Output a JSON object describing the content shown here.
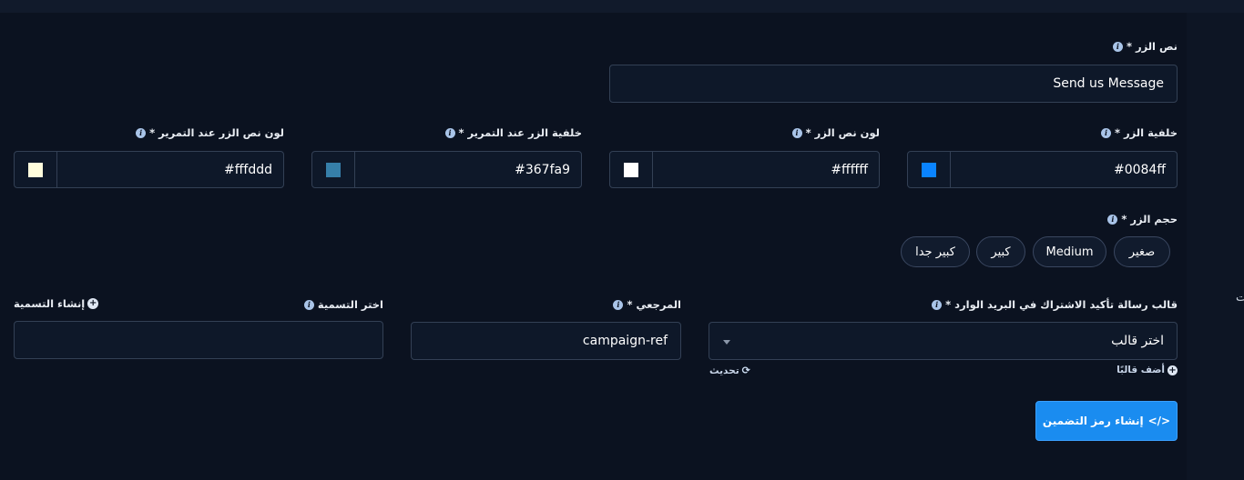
{
  "button_text": {
    "label": "نص الزر *",
    "value": "Send us Message"
  },
  "colors": [
    {
      "label": "خلفية الزر *",
      "value": "#0084ff",
      "swatch": "#0a84ff"
    },
    {
      "label": "لون نص الزر *",
      "value": "#ffffff",
      "swatch": "#ffffff"
    },
    {
      "label": "خلفية الزر عند التمرير *",
      "value": "#367fa9",
      "swatch": "#367fa9"
    },
    {
      "label": "لون نص الزر عند التمرير *",
      "value": "#fffddd",
      "swatch": "#fffddd"
    }
  ],
  "size": {
    "label": "حجم الزر *",
    "options": [
      "صغير",
      "Medium",
      "كبير",
      "كبير جدا"
    ]
  },
  "template": {
    "label": "قالب رسالة تأكيد الاشتراك في البريد الوارد *",
    "placeholder": "اختر قالب",
    "add_link": "أضف قالبًا",
    "refresh_link": "تحديث"
  },
  "reference": {
    "label": "المرجعي *",
    "value": "campaign-ref"
  },
  "tag": {
    "label": "اختر التسمية",
    "create_link": "إنشاء التسمية",
    "value": ""
  },
  "generate_button": "إنشاء رمز التضمين",
  "side_glyph": "ت"
}
